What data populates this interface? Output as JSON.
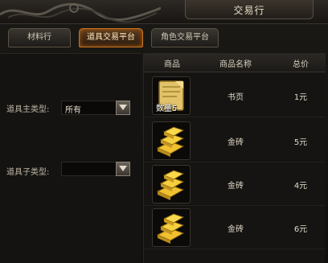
{
  "window": {
    "title": "交易行"
  },
  "tabs": [
    {
      "label": "材料行",
      "active": false
    },
    {
      "label": "道具交易平台",
      "active": true
    },
    {
      "label": "角色交易平台",
      "active": false
    }
  ],
  "filters": {
    "main_type_label": "道具主类型:",
    "main_type_value": "所有",
    "sub_type_label": "道具子类型:",
    "sub_type_value": ""
  },
  "table": {
    "headers": {
      "image": "商品",
      "name": "商品名称",
      "price": "总价"
    },
    "rows": [
      {
        "icon": "book-page-icon",
        "qty": "数量5",
        "name": "书页",
        "price": "1元"
      },
      {
        "icon": "gold-bricks-icon",
        "qty": "",
        "name": "金砖",
        "price": "5元"
      },
      {
        "icon": "gold-bricks-icon",
        "qty": "",
        "name": "金砖",
        "price": "4元"
      },
      {
        "icon": "gold-bricks-icon",
        "qty": "",
        "name": "金砖",
        "price": "6元"
      }
    ]
  },
  "colors": {
    "accent": "#c8741f",
    "gold": "#e8b420",
    "background": "#141311"
  }
}
